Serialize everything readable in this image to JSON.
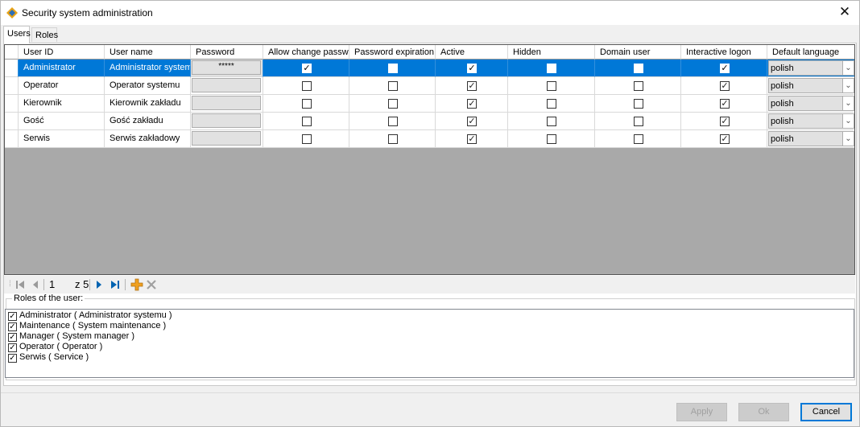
{
  "window": {
    "title": "Security system administration",
    "close_glyph": "✕"
  },
  "tabs": [
    "Users",
    "Roles"
  ],
  "grid": {
    "columns": [
      "User ID",
      "User name",
      "Password",
      "Allow change password",
      "Password expiration",
      "Active",
      "Hidden",
      "Domain user",
      "Interactive logon",
      "Default language"
    ],
    "rows": [
      {
        "user_id": "Administrator",
        "user_name": "Administrator systemu",
        "password": "*****",
        "allow_change": true,
        "expiration": false,
        "active": true,
        "hidden": false,
        "domain": false,
        "interactive": true,
        "language": "polish",
        "selected": true
      },
      {
        "user_id": "Operator",
        "user_name": "Operator systemu",
        "password": "",
        "allow_change": false,
        "expiration": false,
        "active": true,
        "hidden": false,
        "domain": false,
        "interactive": true,
        "language": "polish",
        "selected": false
      },
      {
        "user_id": "Kierownik",
        "user_name": "Kierownik zakładu",
        "password": "",
        "allow_change": false,
        "expiration": false,
        "active": true,
        "hidden": false,
        "domain": false,
        "interactive": true,
        "language": "polish",
        "selected": false
      },
      {
        "user_id": "Gość",
        "user_name": "Gość zakładu",
        "password": "",
        "allow_change": false,
        "expiration": false,
        "active": true,
        "hidden": false,
        "domain": false,
        "interactive": true,
        "language": "polish",
        "selected": false
      },
      {
        "user_id": "Serwis",
        "user_name": "Serwis zakładowy",
        "password": "",
        "allow_change": false,
        "expiration": false,
        "active": true,
        "hidden": false,
        "domain": false,
        "interactive": true,
        "language": "polish",
        "selected": false
      }
    ]
  },
  "navigator": {
    "position": "1",
    "of_total": "z 5",
    "icons": [
      "first-icon",
      "prev-icon",
      "next-icon",
      "last-icon",
      "add-icon",
      "delete-icon"
    ]
  },
  "roles_group": {
    "label": "Roles of the user:",
    "items": [
      {
        "label": "Administrator ( Administrator systemu )",
        "checked": true
      },
      {
        "label": "Maintenance ( System maintenance )",
        "checked": true
      },
      {
        "label": "Manager ( System manager )",
        "checked": true
      },
      {
        "label": "Operator ( Operator )",
        "checked": true
      },
      {
        "label": "Serwis ( Service )",
        "checked": true
      }
    ]
  },
  "buttons": {
    "apply": "Apply",
    "ok": "Ok",
    "cancel": "Cancel"
  },
  "colors": {
    "selection": "#0078d7",
    "grid_empty": "#a9a9a9",
    "nav_blue": "#0063b1",
    "add_orange": "#f0a020"
  }
}
